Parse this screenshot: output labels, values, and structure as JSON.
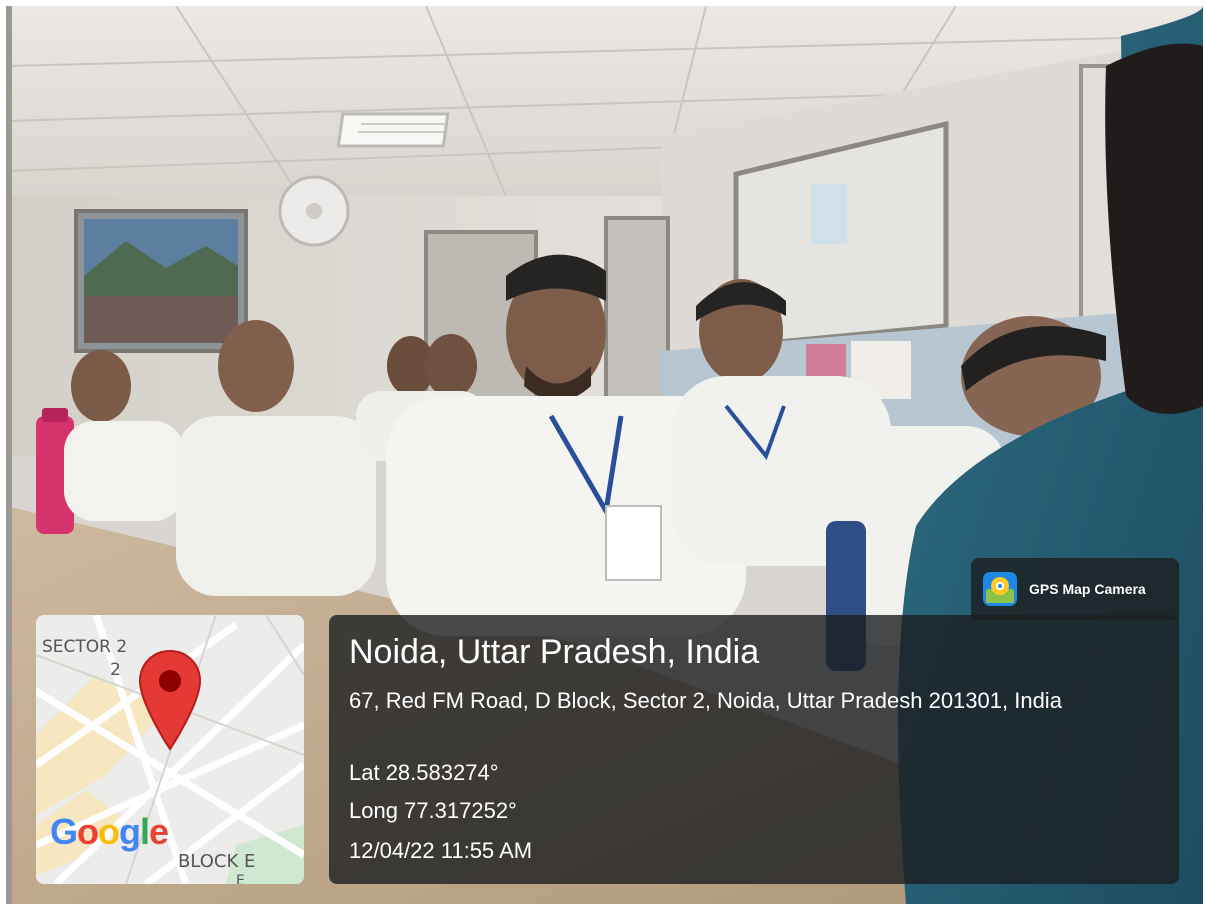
{
  "badge": {
    "app_name": "GPS Map Camera",
    "icon": "map-pin-camera-icon"
  },
  "location": {
    "place": "Noida, Uttar Pradesh, India",
    "address": "67, Red FM Road, D Block, Sector 2, Noida, Uttar Pradesh 201301, India",
    "latitude": "Lat 28.583274°",
    "longitude": "Long 77.317252°",
    "datetime": "12/04/22 11:55 AM"
  },
  "map": {
    "label_sector": "SECTOR 2",
    "label_sector_number": "2",
    "label_block": "BLOCK E",
    "label_block_letter": "E",
    "logo": "Google",
    "pin_icon": "map-pin-icon"
  },
  "colors": {
    "overlay": "#1c1e20",
    "pin": "#e53935",
    "google_blue": "#4285f4",
    "google_red": "#ea4335",
    "google_yellow": "#fbbc05",
    "google_green": "#34a853",
    "bottle": "#d6336c"
  }
}
